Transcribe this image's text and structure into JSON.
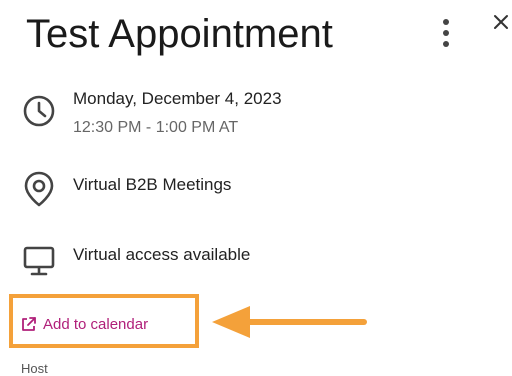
{
  "header": {
    "title": "Test Appointment",
    "more_icon": "more-vertical-icon",
    "close_icon": "close-icon"
  },
  "datetime": {
    "icon": "clock-icon",
    "date": "Monday, December 4, 2023",
    "time": "12:30 PM - 1:00 PM AT"
  },
  "location": {
    "icon": "map-pin-icon",
    "label": "Virtual B2B Meetings"
  },
  "virtual": {
    "icon": "monitor-icon",
    "label": "Virtual access available"
  },
  "calendar": {
    "icon": "external-link-icon",
    "label": "Add to calendar",
    "link_color": "#b0207a"
  },
  "annotation": {
    "highlight_color": "#f4a13a"
  },
  "host": {
    "section_label": "Host"
  }
}
